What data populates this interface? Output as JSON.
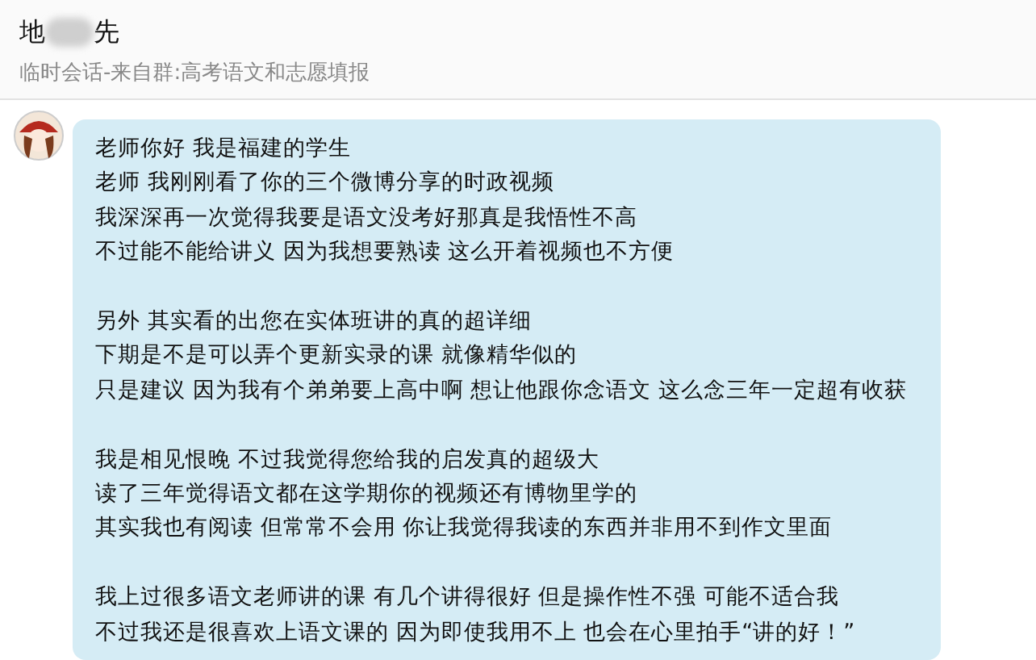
{
  "header": {
    "title_start": "地",
    "title_end": "先",
    "title_blurred": true,
    "subtitle": "临时会话-来自群:高考语文和志愿填报"
  },
  "message": {
    "paragraphs": [
      [
        "老师你好 我是福建的学生",
        "老师 我刚刚看了你的三个微博分享的时政视频",
        "我深深再一次觉得我要是语文没考好那真是我悟性不高",
        "不过能不能给讲义 因为我想要熟读 这么开着视频也不方便"
      ],
      [
        "另外 其实看的出您在实体班讲的真的超详细",
        "下期是不是可以弄个更新实录的课 就像精华似的",
        "只是建议 因为我有个弟弟要上高中啊 想让他跟你念语文 这么念三年一定超有收获"
      ],
      [
        "我是相见恨晚 不过我觉得您给我的启发真的超级大",
        "读了三年觉得语文都在这学期你的视频还有博物里学的",
        "其实我也有阅读 但常常不会用 你让我觉得我读的东西并非用不到作文里面"
      ],
      [
        "我上过很多语文老师讲的课 有几个讲得很好 但是操作性不强 可能不适合我",
        "不过我还是很喜欢上语文课的 因为即使我用不上 也会在心里拍手“讲的好！”"
      ]
    ]
  }
}
